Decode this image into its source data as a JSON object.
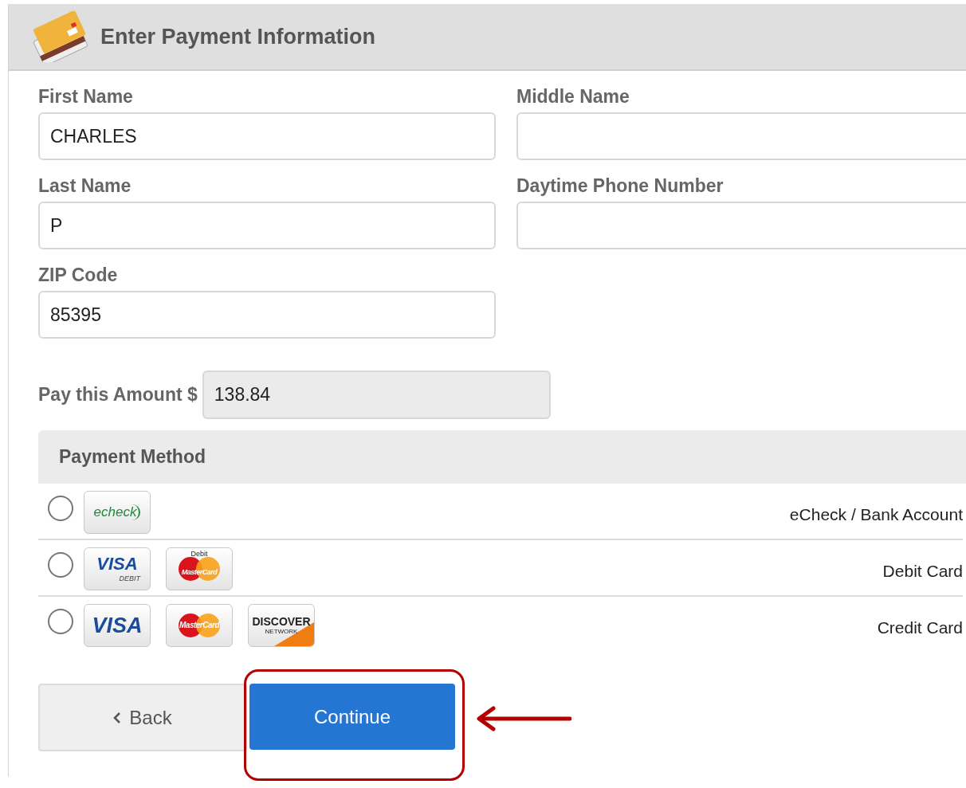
{
  "header": {
    "title": "Enter Payment Information"
  },
  "fields": [
    {
      "label": "First Name",
      "value": "CHARLES"
    },
    {
      "label": "Middle Name"
    },
    {
      "label": "Last Name",
      "value": "P"
    },
    {
      "label": "Daytime Phone Number"
    },
    {
      "label": "ZIP Code",
      "value": "85395"
    }
  ],
  "amount": {
    "label": "Pay this Amount $",
    "value": "138.84"
  },
  "payment_method": {
    "title": "Payment Method",
    "options": [
      {
        "label": "eCheck / Bank Account",
        "selected": false,
        "logos": [
          {
            "kind": "echeck",
            "texts": [
              "echeck"
            ]
          }
        ]
      },
      {
        "label": "Debit Card",
        "selected": false,
        "logos": [
          {
            "kind": "visa_debit",
            "texts": [
              "VISA",
              "DEBIT"
            ]
          },
          {
            "kind": "mastercard_debit",
            "texts": [
              "Debit",
              "MasterCard"
            ]
          }
        ]
      },
      {
        "label": "Credit Card",
        "selected": false,
        "logos": [
          {
            "kind": "visa",
            "texts": [
              "VISA"
            ]
          },
          {
            "kind": "mastercard",
            "texts": [
              "MasterCard"
            ]
          },
          {
            "kind": "discover",
            "texts": [
              "DISCOVER",
              "NETWORK"
            ]
          }
        ]
      }
    ]
  },
  "buttons": [
    {
      "kind": "back",
      "label": "Back",
      "highlighted": false
    },
    {
      "kind": "primary",
      "label": "Continue",
      "highlighted": true
    }
  ]
}
